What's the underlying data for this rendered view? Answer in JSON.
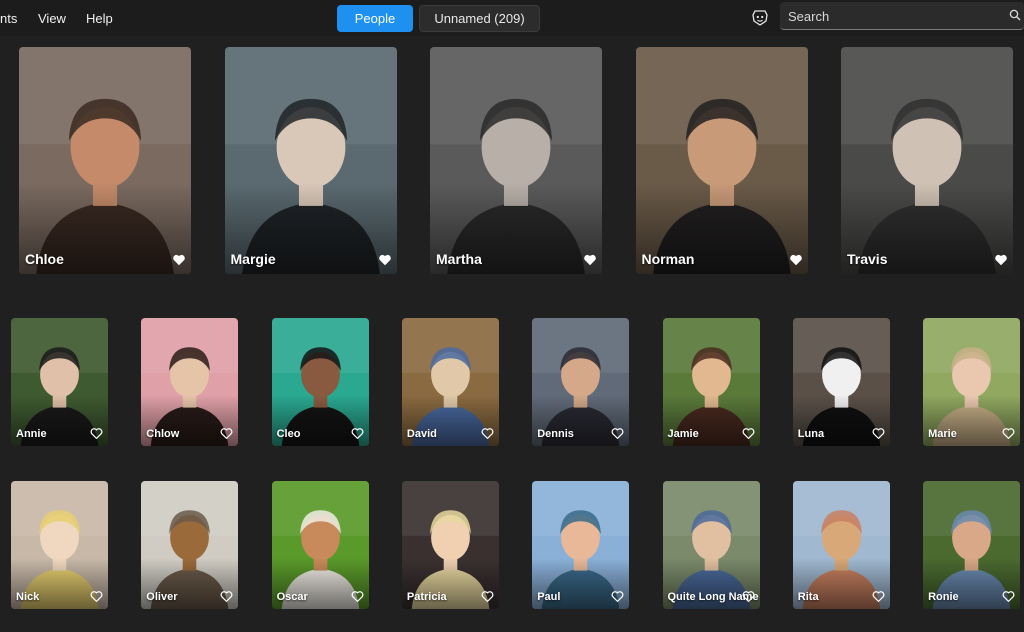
{
  "menu": {
    "items": [
      "nts",
      "View",
      "Help"
    ]
  },
  "tabs": {
    "people": "People",
    "unnamed": "Unnamed (209)"
  },
  "search": {
    "placeholder": "Search"
  },
  "colors": {
    "accent": "#1e90f0",
    "background": "#202020",
    "topbar": "#1c1c1c"
  },
  "people_featured": [
    {
      "name": "Chloe",
      "favorite": true
    },
    {
      "name": "Margie",
      "favorite": true
    },
    {
      "name": "Martha",
      "favorite": true
    },
    {
      "name": "Norman",
      "favorite": true
    },
    {
      "name": "Travis",
      "favorite": true
    }
  ],
  "people_row2": [
    {
      "name": "Annie",
      "favorite": false
    },
    {
      "name": "Chlow",
      "favorite": false
    },
    {
      "name": "Cleo",
      "favorite": false
    },
    {
      "name": "David",
      "favorite": false
    },
    {
      "name": "Dennis",
      "favorite": false
    },
    {
      "name": "Jamie",
      "favorite": false
    },
    {
      "name": "Luna",
      "favorite": false
    },
    {
      "name": "Marie",
      "favorite": false
    }
  ],
  "people_row3": [
    {
      "name": "Nick",
      "favorite": false
    },
    {
      "name": "Oliver",
      "favorite": false
    },
    {
      "name": "Oscar",
      "favorite": false
    },
    {
      "name": "Patricia",
      "favorite": false
    },
    {
      "name": "Paul",
      "favorite": false
    },
    {
      "name": "Quite Long Name",
      "favorite": false
    },
    {
      "name": "Rita",
      "favorite": false
    },
    {
      "name": "Ronie",
      "favorite": false
    }
  ]
}
